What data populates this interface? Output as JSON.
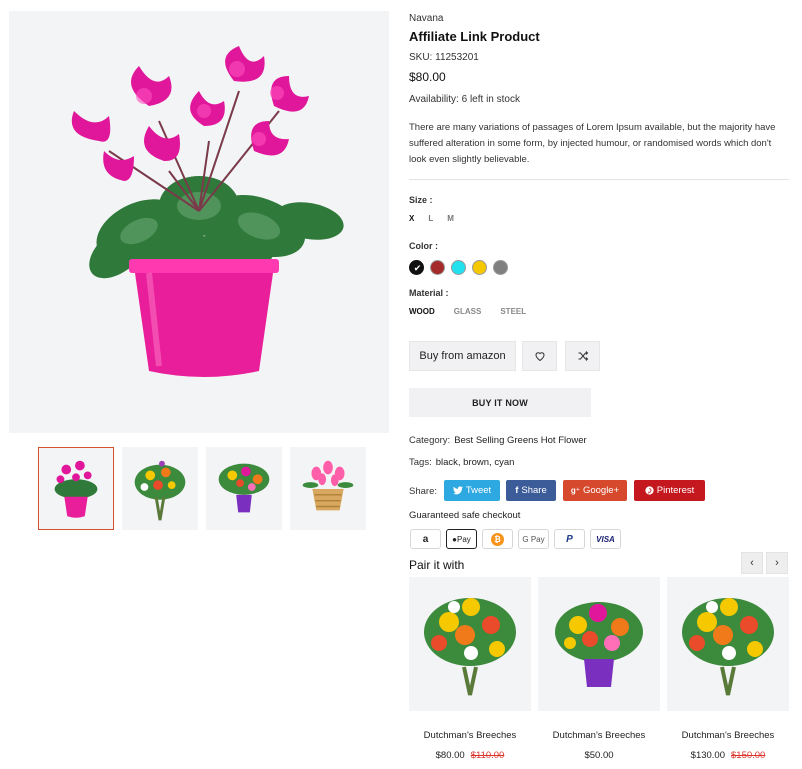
{
  "product": {
    "vendor": "Navana",
    "title": "Affiliate Link Product",
    "sku": "SKU: 11253201",
    "price": "$80.00",
    "availability": "Availability: 6 left in stock",
    "description": "There are many variations of passages of Lorem Ipsum available, but the majority have suffered alteration in some form, by injected humour, or randomised words which don't look even slightly believable."
  },
  "gallery": {
    "thumbnails": [
      {
        "icon": "pink-cyclamen-pot-icon",
        "active": true
      },
      {
        "icon": "mixed-bouquet-icon",
        "active": false
      },
      {
        "icon": "purple-vase-bouquet-icon",
        "active": false
      },
      {
        "icon": "tulip-basket-icon",
        "active": false
      }
    ]
  },
  "options": {
    "size_label": "Size :",
    "sizes": [
      "X",
      "L",
      "M"
    ],
    "selected_size": "X",
    "color_label": "Color :",
    "colors": [
      "#111111",
      "#a52a2a",
      "#22e1ef",
      "#f5c800",
      "#808080"
    ],
    "selected_color": "#111111",
    "material_label": "Material :",
    "materials": [
      "WOOD",
      "GLASS",
      "STEEL"
    ],
    "selected_material": "WOOD"
  },
  "actions": {
    "amazon": "Buy from amazon",
    "buy_now": "BUY IT NOW",
    "wishlist_icon": "heart-icon",
    "compare_icon": "shuffle-icon"
  },
  "meta": {
    "category_label": "Category:",
    "category_value": "Best Selling Greens Hot Flower",
    "tags_label": "Tags:",
    "tags_value": "black, brown, cyan"
  },
  "share": {
    "label": "Share:",
    "tweet": "Tweet",
    "facebook": "Share",
    "google": "Google+",
    "pinterest": "Pinterest"
  },
  "checkout": {
    "label": "Guaranteed safe checkout",
    "payments": [
      "amazon",
      "Pay",
      "bitcoin",
      "G Pay",
      "paypal",
      "VISA"
    ]
  },
  "pair": {
    "title": "Pair it with",
    "products": [
      {
        "name": "Dutchman's Breeches",
        "price": "$80.00",
        "old_price": "$110.00"
      },
      {
        "name": "Dutchman's Breeches",
        "price": "$50.00",
        "old_price": ""
      },
      {
        "name": "Dutchman's Breeches",
        "price": "$130.00",
        "old_price": "$150.00"
      }
    ]
  }
}
